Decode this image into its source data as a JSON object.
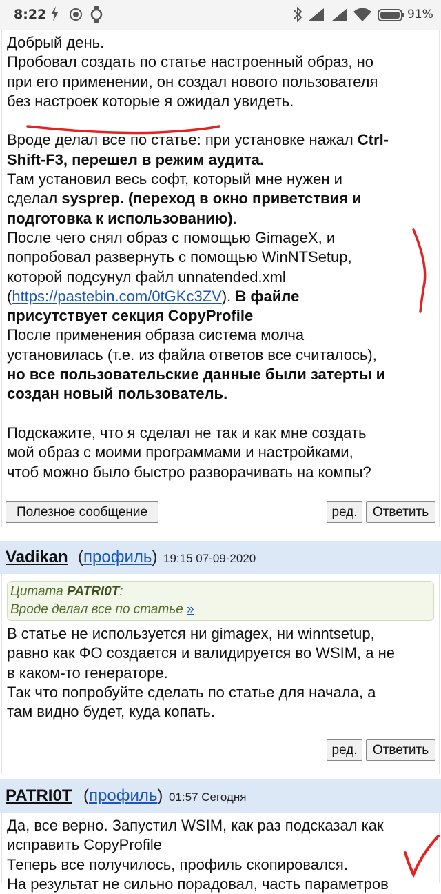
{
  "status_bar": {
    "time": "8:22",
    "battery_percent": "91%",
    "icons": [
      "bolt-icon",
      "record-icon",
      "watch-icon",
      "bluetooth-icon",
      "signal-icon",
      "signal-icon",
      "wifi-icon",
      "battery-icon"
    ]
  },
  "posts": [
    {
      "lines": [
        [
          {
            "t": "Добрый день."
          }
        ],
        [
          {
            "t": "Пробовал создать по статье настроенный образ, но"
          }
        ],
        [
          {
            "t": "при его применении, он создал нового пользователя"
          }
        ],
        [
          {
            "t": "без настроек которые я ожидал увидеть."
          }
        ],
        [],
        [
          {
            "t": "Вроде делал все по статье: при установке нажал "
          },
          {
            "t": "Ctrl-",
            "b": true
          }
        ],
        [
          {
            "t": "Shift-F3, перешел в режим аудита.",
            "b": true
          }
        ],
        [
          {
            "t": "Там установил весь софт, который мне нужен и"
          }
        ],
        [
          {
            "t": "сделал "
          },
          {
            "t": "sysprep. (переход в окно приветствия и",
            "b": true
          }
        ],
        [
          {
            "t": "подготовка к использованию)",
            "b": true
          },
          {
            "t": "."
          }
        ],
        [
          {
            "t": "После чего снял образ с помощью GimageX, и"
          }
        ],
        [
          {
            "t": "попробовал развернуть с помощью WinNTSetup,"
          }
        ],
        [
          {
            "t": "которой подсунул файл unnatended.xml"
          }
        ],
        [
          {
            "t": "("
          },
          {
            "t": "https://pastebin.com/0tGKc3ZV",
            "link": true
          },
          {
            "t": "). "
          },
          {
            "t": "В файле",
            "b": true
          }
        ],
        [
          {
            "t": "присутствует секция CopyProfile",
            "b": true
          }
        ],
        [
          {
            "t": "После применения образа система молча"
          }
        ],
        [
          {
            "t": "установилась (т.е. из файла ответов все считалось),"
          }
        ],
        [
          {
            "t": "но все пользовательские данные были затерты и",
            "b": true
          }
        ],
        [
          {
            "t": "создан новый пользователь.",
            "b": true
          }
        ],
        [],
        [
          {
            "t": "Подскажите, что я сделал не так и как мне создать"
          }
        ],
        [
          {
            "t": "мой образ с моими программами и настройками,"
          }
        ],
        [
          {
            "t": "чтоб можно было быстро разворачивать на компы?"
          }
        ]
      ],
      "buttons": {
        "useful": "Полезное сообщение",
        "edit": "ред.",
        "reply": "Ответить"
      }
    },
    {
      "author": "Vadikan",
      "profile_open": "(",
      "profile_link": "профиль",
      "profile_close": ")",
      "timestamp": "19:15 07-09-2020",
      "quote": {
        "prefix": "Цитата ",
        "author": "PATRI0T",
        "suffix": ":",
        "text": "Вроде делал все по статье ",
        "link": "»"
      },
      "lines": [
        [
          {
            "t": "В статье не используется ни gimagex, ни winntsetup,"
          }
        ],
        [
          {
            "t": "равно как ФО создается и валидируется во WSIM, а не"
          }
        ],
        [
          {
            "t": "в каком-то генераторе."
          }
        ],
        [
          {
            "t": "Так что попробуйте сделать по статье для начала, а"
          }
        ],
        [
          {
            "t": "там видно будет, куда копать."
          }
        ]
      ],
      "buttons": {
        "edit": "ред.",
        "reply": "Ответить"
      }
    },
    {
      "author": "PATRI0T",
      "profile_open": "(",
      "profile_link": "профиль",
      "profile_close": ")",
      "timestamp": "01:57 Сегодня",
      "lines": [
        [
          {
            "t": "Да, все верно. Запустил WSIM, как раз подсказал как"
          }
        ],
        [
          {
            "t": "исправить CopyProfile"
          }
        ],
        [
          {
            "t": "Теперь все получилось, профиль скопировался."
          }
        ],
        [
          {
            "t": "На результат не сильно порадовал, часть параметров"
          }
        ]
      ]
    }
  ]
}
